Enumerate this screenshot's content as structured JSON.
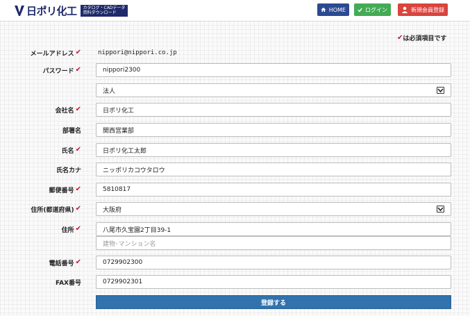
{
  "header": {
    "logo_text": "日ポリ化工",
    "logo_badge_line1": "カタログ・CADデータ",
    "logo_badge_line2": "資料ダウンロード",
    "home_label": "HOME",
    "login_label": "ログイン",
    "register_label": "新規会員登録"
  },
  "colors": {
    "brand": "#1f2a6b",
    "home_button": "#2b4a91",
    "login_button": "#43ab55",
    "register_button": "#d9443d",
    "required_mark": "#c8102e",
    "submit_button": "#3272ad"
  },
  "form": {
    "required_note": "は必須項目です",
    "email": {
      "label": "メールアドレス",
      "value": "nippori@nippori.co.jp"
    },
    "password": {
      "label": "パスワード",
      "value": "nippori2300"
    },
    "entity_type": {
      "value": "法人"
    },
    "company": {
      "label": "会社名",
      "value": "日ポリ化工"
    },
    "department": {
      "label": "部署名",
      "value": "関西営業部"
    },
    "name": {
      "label": "氏名",
      "value": "日ポリ化工太郎"
    },
    "name_kana": {
      "label": "氏名カナ",
      "value": "ニッポリカコウタロウ"
    },
    "postal_code": {
      "label": "郵便番号",
      "value": "5810817"
    },
    "prefecture": {
      "label": "住所(都道府県)",
      "value": "大阪府"
    },
    "address": {
      "label": "住所",
      "value": "八尾市久宝園2丁目39-1",
      "building_placeholder": "建物･マンション名"
    },
    "phone": {
      "label": "電話番号",
      "value": "0729902300"
    },
    "fax": {
      "label": "FAX番号",
      "value": "0729902301"
    },
    "submit_label": "登録する"
  }
}
